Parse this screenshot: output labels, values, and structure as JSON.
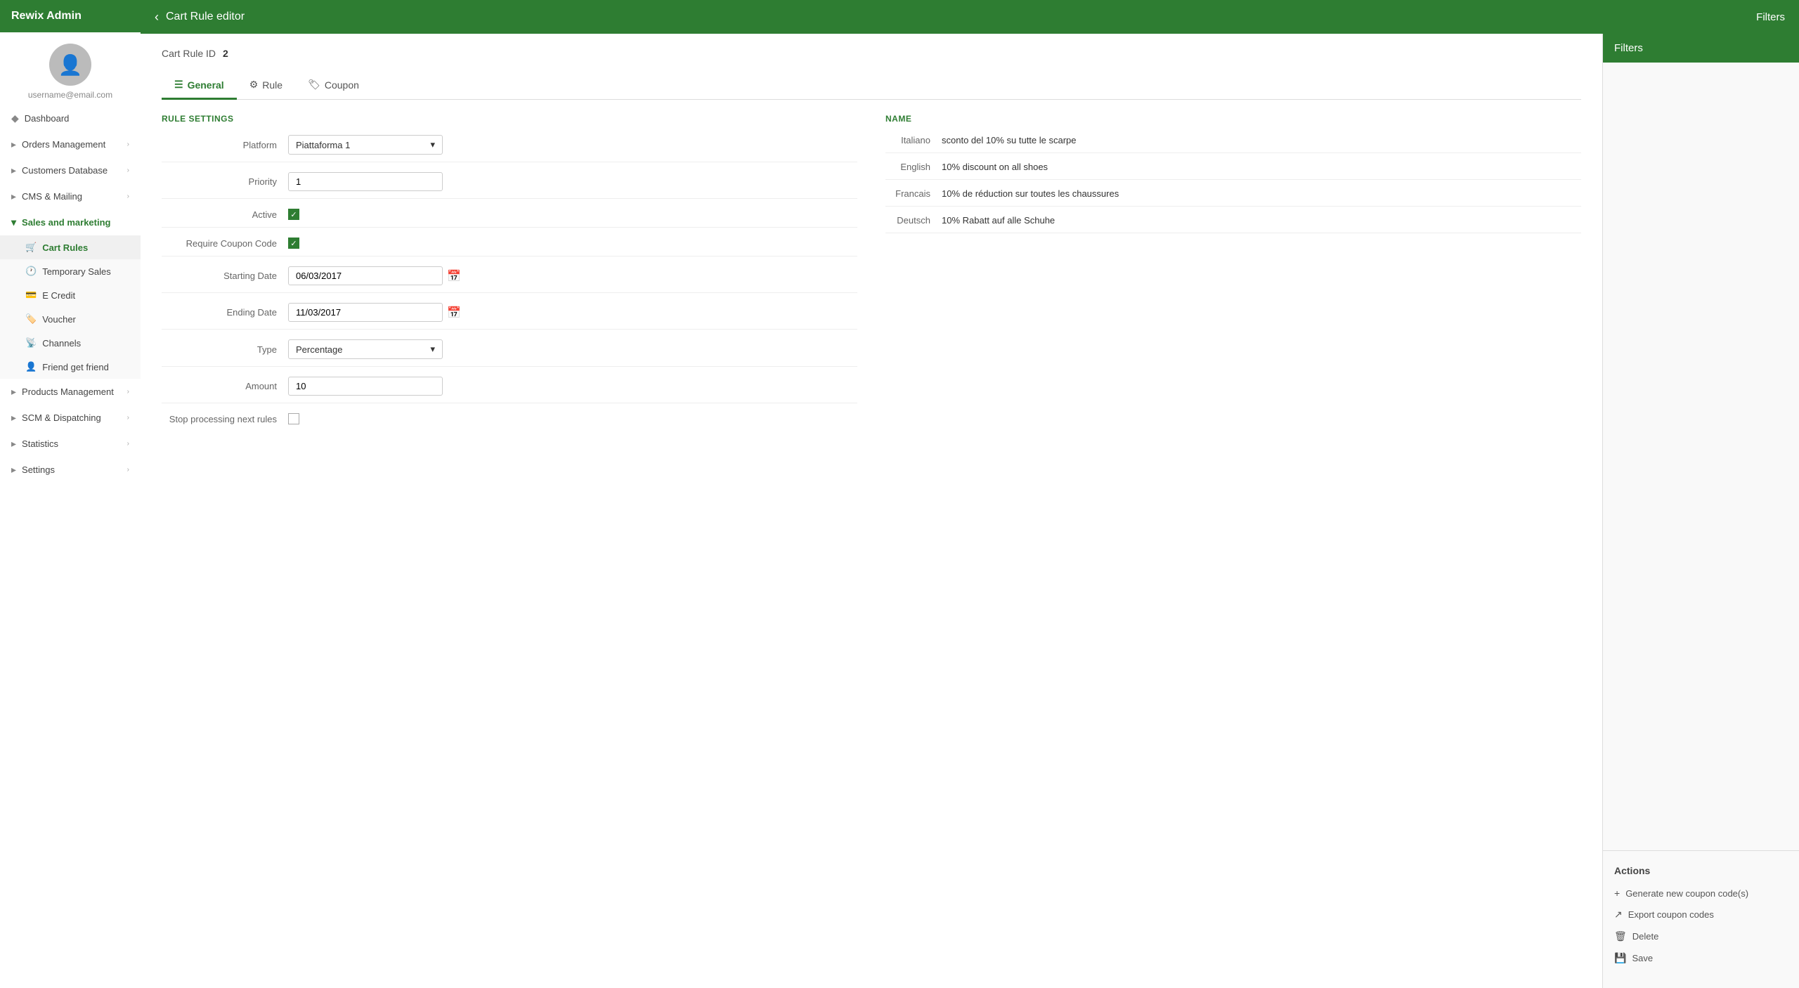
{
  "sidebar": {
    "app_name": "Rewix Admin",
    "avatar_icon": "👤",
    "avatar_name": "username@email.com",
    "notification_icon": "🔔",
    "nav_items": [
      {
        "id": "dashboard",
        "label": "Dashboard",
        "icon": "💠",
        "has_children": false
      },
      {
        "id": "orders",
        "label": "Orders Management",
        "icon": "📄",
        "has_children": true
      },
      {
        "id": "customers",
        "label": "Customers Database",
        "icon": "👥",
        "has_children": true
      },
      {
        "id": "cms",
        "label": "CMS & Mailing",
        "icon": "✉️",
        "has_children": true
      },
      {
        "id": "sales",
        "label": "Sales and marketing",
        "icon": "🛒",
        "has_children": true,
        "expanded": true
      },
      {
        "id": "products",
        "label": "Products Management",
        "icon": "📦",
        "has_children": true
      },
      {
        "id": "scm",
        "label": "SCM & Dispatching",
        "icon": "🚚",
        "has_children": true
      },
      {
        "id": "statistics",
        "label": "Statistics",
        "icon": "📊",
        "has_children": true
      },
      {
        "id": "settings",
        "label": "Settings",
        "icon": "⚙️",
        "has_children": true
      }
    ],
    "sub_items": [
      {
        "id": "cart-rules",
        "label": "Cart Rules",
        "icon": "🛒",
        "active": true
      },
      {
        "id": "temporary-sales",
        "label": "Temporary Sales",
        "icon": "🕐"
      },
      {
        "id": "e-credit",
        "label": "E Credit",
        "icon": "💳"
      },
      {
        "id": "voucher",
        "label": "Voucher",
        "icon": "🏷️"
      },
      {
        "id": "channels",
        "label": "Channels",
        "icon": "📡"
      },
      {
        "id": "friend-get-friend",
        "label": "Friend get friend",
        "icon": "👤"
      }
    ]
  },
  "topbar": {
    "back_label": "‹",
    "title": "Cart Rule editor",
    "filters_label": "Filters"
  },
  "cart_rule": {
    "id_label": "Cart Rule ID",
    "id_value": "2"
  },
  "tabs": [
    {
      "id": "general",
      "label": "General",
      "icon": "≡",
      "active": true
    },
    {
      "id": "rule",
      "label": "Rule",
      "icon": "⚙"
    },
    {
      "id": "coupon",
      "label": "Coupon",
      "icon": "🏷"
    }
  ],
  "rule_settings": {
    "section_title": "RULE SETTINGS",
    "fields": [
      {
        "id": "platform",
        "label": "Platform",
        "type": "select",
        "value": "Piattaforma 1"
      },
      {
        "id": "priority",
        "label": "Priority",
        "type": "text",
        "value": "1"
      },
      {
        "id": "active",
        "label": "Active",
        "type": "checkbox",
        "checked": true
      },
      {
        "id": "require-coupon",
        "label": "Require Coupon Code",
        "type": "checkbox",
        "checked": true
      },
      {
        "id": "starting-date",
        "label": "Starting Date",
        "type": "date",
        "value": "06/03/2017"
      },
      {
        "id": "ending-date",
        "label": "Ending Date",
        "type": "date",
        "value": "11/03/2017"
      },
      {
        "id": "type",
        "label": "Type",
        "type": "select",
        "value": "Percentage"
      },
      {
        "id": "amount",
        "label": "Amount",
        "type": "text",
        "value": "10"
      },
      {
        "id": "stop-processing",
        "label": "Stop processing next rules",
        "type": "checkbox",
        "checked": false
      }
    ]
  },
  "name_section": {
    "section_title": "NAME",
    "entries": [
      {
        "lang": "Italiano",
        "value": "sconto del 10% su tutte le scarpe"
      },
      {
        "lang": "English",
        "value": "10% discount on all shoes"
      },
      {
        "lang": "Francais",
        "value": "10% de réduction sur toutes les chaussures"
      },
      {
        "lang": "Deutsch",
        "value": "10% Rabatt auf alle Schuhe"
      }
    ]
  },
  "right_panel": {
    "filters_label": "Filters",
    "actions_title": "Actions",
    "action_items": [
      {
        "id": "generate-coupon",
        "icon": "+",
        "label": "Generate new coupon code(s)"
      },
      {
        "id": "export-coupon",
        "icon": "↗",
        "label": "Export coupon codes"
      },
      {
        "id": "delete",
        "icon": "🗑",
        "label": "Delete"
      },
      {
        "id": "save",
        "icon": "💾",
        "label": "Save"
      }
    ]
  }
}
